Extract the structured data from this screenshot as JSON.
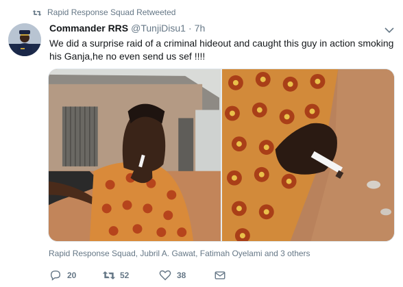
{
  "retweet_context": {
    "text": "Rapid Response Squad Retweeted",
    "icon": "retweet-icon"
  },
  "author": {
    "name": "Commander RRS",
    "handle": "@TunjiDisu1",
    "separator": "·",
    "time": "7h"
  },
  "tweet": {
    "text": "We did a surprise raid of a criminal hideout and caught this guy in action smoking his Ganja,he no even send us sef !!!!"
  },
  "media": {
    "photos": [
      "photo-man-smoking",
      "photo-hand-cigarette"
    ]
  },
  "likers": {
    "text": "Rapid Response Squad, Jubril A. Gawat, Fatimah Oyelami and 3 others"
  },
  "actions": {
    "reply": {
      "icon": "reply-icon",
      "count": "20"
    },
    "retweet": {
      "icon": "retweet-icon",
      "count": "52"
    },
    "like": {
      "icon": "heart-icon",
      "count": "38"
    },
    "message": {
      "icon": "envelope-icon"
    }
  },
  "colors": {
    "text_primary": "#14171a",
    "text_secondary": "#657786",
    "background": "#ffffff"
  }
}
